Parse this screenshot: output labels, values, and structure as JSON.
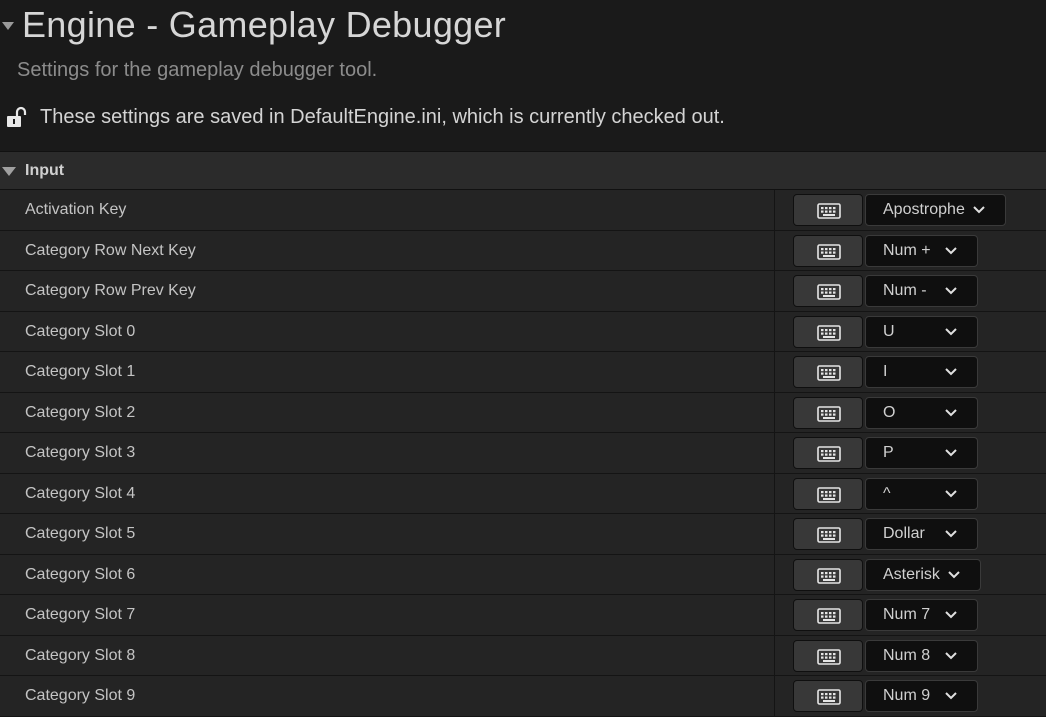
{
  "header": {
    "title": "Engine - Gameplay Debugger",
    "subtitle": "Settings for the gameplay debugger tool.",
    "config_note": "These settings are saved in DefaultEngine.ini, which is currently checked out."
  },
  "category": {
    "label": "Input"
  },
  "rows": [
    {
      "label": "Activation Key",
      "key": "Apostrophe"
    },
    {
      "label": "Category Row Next Key",
      "key": "Num +"
    },
    {
      "label": "Category Row Prev Key",
      "key": "Num -"
    },
    {
      "label": "Category Slot 0",
      "key": "U"
    },
    {
      "label": "Category Slot 1",
      "key": "I"
    },
    {
      "label": "Category Slot 2",
      "key": "O"
    },
    {
      "label": "Category Slot 3",
      "key": "P"
    },
    {
      "label": "Category Slot 4",
      "key": "^"
    },
    {
      "label": "Category Slot 5",
      "key": "Dollar"
    },
    {
      "label": "Category Slot 6",
      "key": "Asterisk"
    },
    {
      "label": "Category Slot 7",
      "key": "Num 7"
    },
    {
      "label": "Category Slot 8",
      "key": "Num 8"
    },
    {
      "label": "Category Slot 9",
      "key": "Num 9"
    }
  ],
  "icons": {
    "section_toggle": "triangle-down-icon",
    "lock": "unlocked-padlock-icon",
    "keyboard": "keyboard-icon",
    "dropdown": "chevron-down-icon"
  },
  "colors": {
    "background": "#1a1a1a",
    "row_background": "#242424",
    "category_background": "#2b2b2b",
    "combo_background": "#0f0f0f",
    "button_background": "#383838"
  }
}
